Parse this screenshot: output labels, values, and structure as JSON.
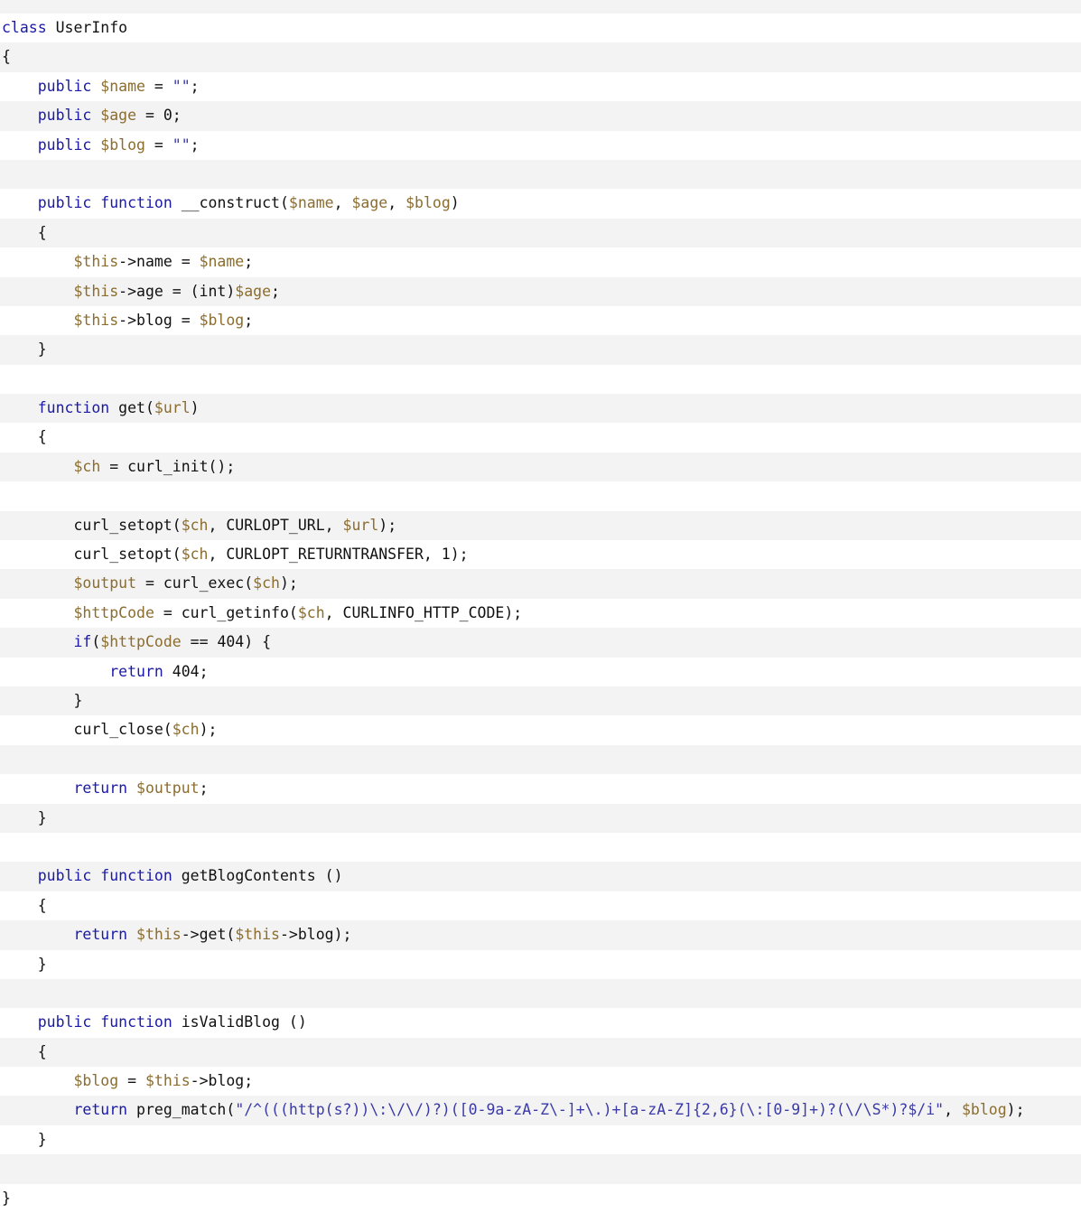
{
  "colors": {
    "keyword": "#1a1aa6",
    "variable": "#8b6d2f",
    "string": "#3a3aa8",
    "plain": "#111111",
    "row_alt": "#f3f3f3",
    "row_base": "#ffffff"
  },
  "code": {
    "language": "php",
    "lines": [
      [
        {
          "t": "kw",
          "v": "class"
        },
        {
          "t": "plain",
          "v": " UserInfo"
        }
      ],
      [
        {
          "t": "plain",
          "v": "{"
        }
      ],
      [
        {
          "t": "plain",
          "v": "    "
        },
        {
          "t": "kw",
          "v": "public"
        },
        {
          "t": "plain",
          "v": " "
        },
        {
          "t": "var",
          "v": "$name"
        },
        {
          "t": "plain",
          "v": " = "
        },
        {
          "t": "str",
          "v": "\"\""
        },
        {
          "t": "plain",
          "v": ";"
        }
      ],
      [
        {
          "t": "plain",
          "v": "    "
        },
        {
          "t": "kw",
          "v": "public"
        },
        {
          "t": "plain",
          "v": " "
        },
        {
          "t": "var",
          "v": "$age"
        },
        {
          "t": "plain",
          "v": " = 0;"
        }
      ],
      [
        {
          "t": "plain",
          "v": "    "
        },
        {
          "t": "kw",
          "v": "public"
        },
        {
          "t": "plain",
          "v": " "
        },
        {
          "t": "var",
          "v": "$blog"
        },
        {
          "t": "plain",
          "v": " = "
        },
        {
          "t": "str",
          "v": "\"\""
        },
        {
          "t": "plain",
          "v": ";"
        }
      ],
      [],
      [
        {
          "t": "plain",
          "v": "    "
        },
        {
          "t": "kw",
          "v": "public"
        },
        {
          "t": "plain",
          "v": " "
        },
        {
          "t": "kw",
          "v": "function"
        },
        {
          "t": "plain",
          "v": " __construct("
        },
        {
          "t": "var",
          "v": "$name"
        },
        {
          "t": "plain",
          "v": ", "
        },
        {
          "t": "var",
          "v": "$age"
        },
        {
          "t": "plain",
          "v": ", "
        },
        {
          "t": "var",
          "v": "$blog"
        },
        {
          "t": "plain",
          "v": ")"
        }
      ],
      [
        {
          "t": "plain",
          "v": "    {"
        }
      ],
      [
        {
          "t": "plain",
          "v": "        "
        },
        {
          "t": "var",
          "v": "$this"
        },
        {
          "t": "plain",
          "v": "->name = "
        },
        {
          "t": "var",
          "v": "$name"
        },
        {
          "t": "plain",
          "v": ";"
        }
      ],
      [
        {
          "t": "plain",
          "v": "        "
        },
        {
          "t": "var",
          "v": "$this"
        },
        {
          "t": "plain",
          "v": "->age = (int)"
        },
        {
          "t": "var",
          "v": "$age"
        },
        {
          "t": "plain",
          "v": ";"
        }
      ],
      [
        {
          "t": "plain",
          "v": "        "
        },
        {
          "t": "var",
          "v": "$this"
        },
        {
          "t": "plain",
          "v": "->blog = "
        },
        {
          "t": "var",
          "v": "$blog"
        },
        {
          "t": "plain",
          "v": ";"
        }
      ],
      [
        {
          "t": "plain",
          "v": "    }"
        }
      ],
      [],
      [
        {
          "t": "plain",
          "v": "    "
        },
        {
          "t": "kw",
          "v": "function"
        },
        {
          "t": "plain",
          "v": " get("
        },
        {
          "t": "var",
          "v": "$url"
        },
        {
          "t": "plain",
          "v": ")"
        }
      ],
      [
        {
          "t": "plain",
          "v": "    {"
        }
      ],
      [
        {
          "t": "plain",
          "v": "        "
        },
        {
          "t": "var",
          "v": "$ch"
        },
        {
          "t": "plain",
          "v": " = curl_init();"
        }
      ],
      [],
      [
        {
          "t": "plain",
          "v": "        curl_setopt("
        },
        {
          "t": "var",
          "v": "$ch"
        },
        {
          "t": "plain",
          "v": ", CURLOPT_URL, "
        },
        {
          "t": "var",
          "v": "$url"
        },
        {
          "t": "plain",
          "v": ");"
        }
      ],
      [
        {
          "t": "plain",
          "v": "        curl_setopt("
        },
        {
          "t": "var",
          "v": "$ch"
        },
        {
          "t": "plain",
          "v": ", CURLOPT_RETURNTRANSFER, 1);"
        }
      ],
      [
        {
          "t": "plain",
          "v": "        "
        },
        {
          "t": "var",
          "v": "$output"
        },
        {
          "t": "plain",
          "v": " = curl_exec("
        },
        {
          "t": "var",
          "v": "$ch"
        },
        {
          "t": "plain",
          "v": ");"
        }
      ],
      [
        {
          "t": "plain",
          "v": "        "
        },
        {
          "t": "var",
          "v": "$httpCode"
        },
        {
          "t": "plain",
          "v": " = curl_getinfo("
        },
        {
          "t": "var",
          "v": "$ch"
        },
        {
          "t": "plain",
          "v": ", CURLINFO_HTTP_CODE);"
        }
      ],
      [
        {
          "t": "plain",
          "v": "        "
        },
        {
          "t": "kw",
          "v": "if"
        },
        {
          "t": "plain",
          "v": "("
        },
        {
          "t": "var",
          "v": "$httpCode"
        },
        {
          "t": "plain",
          "v": " == 404) {"
        }
      ],
      [
        {
          "t": "plain",
          "v": "            "
        },
        {
          "t": "kw",
          "v": "return"
        },
        {
          "t": "plain",
          "v": " 404;"
        }
      ],
      [
        {
          "t": "plain",
          "v": "        }"
        }
      ],
      [
        {
          "t": "plain",
          "v": "        curl_close("
        },
        {
          "t": "var",
          "v": "$ch"
        },
        {
          "t": "plain",
          "v": ");"
        }
      ],
      [],
      [
        {
          "t": "plain",
          "v": "        "
        },
        {
          "t": "kw",
          "v": "return"
        },
        {
          "t": "plain",
          "v": " "
        },
        {
          "t": "var",
          "v": "$output"
        },
        {
          "t": "plain",
          "v": ";"
        }
      ],
      [
        {
          "t": "plain",
          "v": "    }"
        }
      ],
      [],
      [
        {
          "t": "plain",
          "v": "    "
        },
        {
          "t": "kw",
          "v": "public"
        },
        {
          "t": "plain",
          "v": " "
        },
        {
          "t": "kw",
          "v": "function"
        },
        {
          "t": "plain",
          "v": " getBlogContents ()"
        }
      ],
      [
        {
          "t": "plain",
          "v": "    {"
        }
      ],
      [
        {
          "t": "plain",
          "v": "        "
        },
        {
          "t": "kw",
          "v": "return"
        },
        {
          "t": "plain",
          "v": " "
        },
        {
          "t": "var",
          "v": "$this"
        },
        {
          "t": "plain",
          "v": "->get("
        },
        {
          "t": "var",
          "v": "$this"
        },
        {
          "t": "plain",
          "v": "->blog);"
        }
      ],
      [
        {
          "t": "plain",
          "v": "    }"
        }
      ],
      [],
      [
        {
          "t": "plain",
          "v": "    "
        },
        {
          "t": "kw",
          "v": "public"
        },
        {
          "t": "plain",
          "v": " "
        },
        {
          "t": "kw",
          "v": "function"
        },
        {
          "t": "plain",
          "v": " isValidBlog ()"
        }
      ],
      [
        {
          "t": "plain",
          "v": "    {"
        }
      ],
      [
        {
          "t": "plain",
          "v": "        "
        },
        {
          "t": "var",
          "v": "$blog"
        },
        {
          "t": "plain",
          "v": " = "
        },
        {
          "t": "var",
          "v": "$this"
        },
        {
          "t": "plain",
          "v": "->blog;"
        }
      ],
      [
        {
          "t": "plain",
          "v": "        "
        },
        {
          "t": "kw",
          "v": "return"
        },
        {
          "t": "plain",
          "v": " preg_match("
        },
        {
          "t": "str",
          "v": "\"/^(((http(s?))\\:\\/\\/)?)([0-9a-zA-Z\\-]+\\.)+[a-zA-Z]{2,6}(\\:[0-9]+)?(\\/\\S*)?$/i\""
        },
        {
          "t": "plain",
          "v": ", "
        },
        {
          "t": "var",
          "v": "$blog"
        },
        {
          "t": "plain",
          "v": ");"
        }
      ],
      [
        {
          "t": "plain",
          "v": "    }"
        }
      ],
      [],
      [
        {
          "t": "plain",
          "v": "}"
        }
      ]
    ]
  }
}
